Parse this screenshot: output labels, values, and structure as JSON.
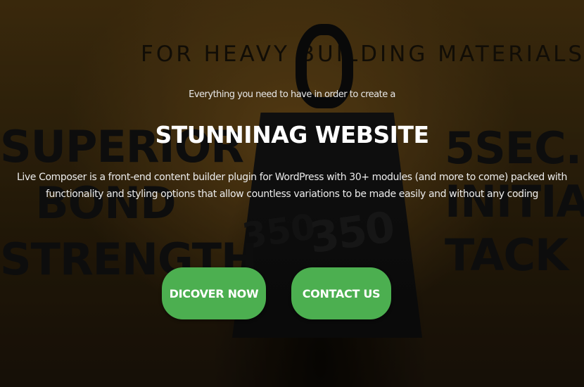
{
  "background": {
    "top_text": "FOR HEAVY BUILDING MATERIALS",
    "left_text": [
      "SUPERIOR",
      "BOND",
      "STRENGTH"
    ],
    "right_text": [
      "5SEC.",
      "INITIAL",
      "TACK"
    ],
    "weight_numbers": [
      "350",
      "350"
    ]
  },
  "hero": {
    "pretitle": "Everything you need to have in order to create a",
    "title": "STUNNINAG WEBSITE",
    "description": "Live Composer is a front-end content builder plugin for WordPress with 30+ modules (and more to come) packed with functionality and styling options that allow countless variations to be made easily and without any coding"
  },
  "buttons": {
    "discover_label": "DICOVER NOW",
    "contact_label": "CONTACT US"
  },
  "colors": {
    "button_green": "#4caf50",
    "text_white": "#ffffff"
  }
}
